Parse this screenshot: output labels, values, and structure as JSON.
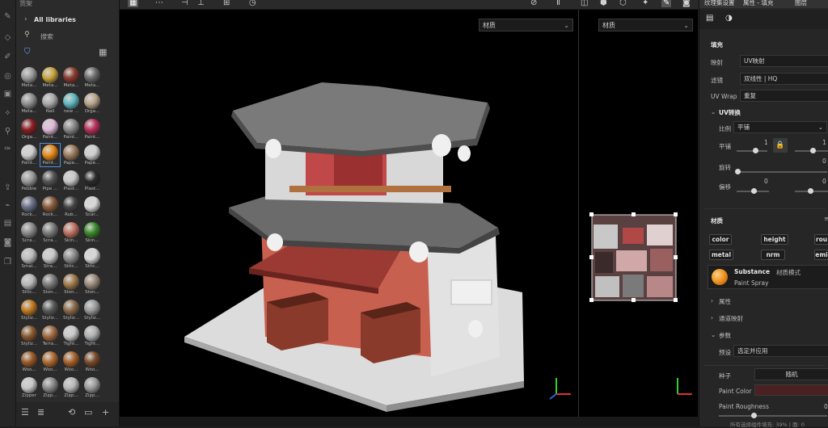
{
  "shelf": {
    "title": "货架",
    "nav_label": "All libraries",
    "search_label": "搜索",
    "swatches": [
      {
        "label": "Meta...",
        "color": "#9a9a9a"
      },
      {
        "label": "Meta...",
        "color": "#c9a53c"
      },
      {
        "label": "Meta...",
        "color": "#8a3b2c"
      },
      {
        "label": "Meta...",
        "color": "#6a6a6a"
      },
      {
        "label": "Meta...",
        "color": "#8f8f8f"
      },
      {
        "label": "Nail",
        "color": "#a9a9a9"
      },
      {
        "label": "new ...",
        "color": "#5fb8c0"
      },
      {
        "label": "Orga...",
        "color": "#b8a48a"
      },
      {
        "label": "Orga...",
        "color": "#8a1e22"
      },
      {
        "label": "Paint...",
        "color": "#e0b8d8"
      },
      {
        "label": "Paint...",
        "color": "#888888"
      },
      {
        "label": "Paint...",
        "color": "#b8305a"
      },
      {
        "label": "Paint...",
        "color": "#cfcfcf"
      },
      {
        "label": "Paint...",
        "color": "#e88a18"
      },
      {
        "label": "Pape...",
        "color": "#9a7a5a"
      },
      {
        "label": "Pape...",
        "color": "#d0d0d0"
      },
      {
        "label": "Pebble",
        "color": "#9a9a9a"
      },
      {
        "label": "Pipe ...",
        "color": "#555555"
      },
      {
        "label": "Plast...",
        "color": "#c8c8c8"
      },
      {
        "label": "Plast...",
        "color": "#2a2a2a"
      },
      {
        "label": "Rock...",
        "color": "#6a7088"
      },
      {
        "label": "Rock...",
        "color": "#8a5a3a"
      },
      {
        "label": "Rub...",
        "color": "#444444"
      },
      {
        "label": "Scar...",
        "color": "#d8d8d8"
      },
      {
        "label": "Scra...",
        "color": "#8a8a8a"
      },
      {
        "label": "Scra...",
        "color": "#7a7a7a"
      },
      {
        "label": "Skin...",
        "color": "#c07060"
      },
      {
        "label": "Skin...",
        "color": "#3a8a2a"
      },
      {
        "label": "Smal...",
        "color": "#bdbdbd"
      },
      {
        "label": "Stra...",
        "color": "#c8c8c8"
      },
      {
        "label": "Stitc...",
        "color": "#8a8a8a"
      },
      {
        "label": "Stitc...",
        "color": "#d8d8d8"
      },
      {
        "label": "Stitc...",
        "color": "#b8b8b8"
      },
      {
        "label": "Ston...",
        "color": "#7a7a7a"
      },
      {
        "label": "Ston...",
        "color": "#a07a4a"
      },
      {
        "label": "Ston...",
        "color": "#9a8a7a"
      },
      {
        "label": "Styliz...",
        "color": "#c07a20"
      },
      {
        "label": "Styliz...",
        "color": "#5a5a5a"
      },
      {
        "label": "Styliz...",
        "color": "#8a6a4a"
      },
      {
        "label": "Styliz...",
        "color": "#9a9a9a"
      },
      {
        "label": "Styliz...",
        "color": "#8a5a30"
      },
      {
        "label": "Terra...",
        "color": "#a06a40"
      },
      {
        "label": "Tight...",
        "color": "#c8c8c8"
      },
      {
        "label": "Tight...",
        "color": "#b0b0b0"
      },
      {
        "label": "Woo...",
        "color": "#9a5a28"
      },
      {
        "label": "Woo...",
        "color": "#b06a30"
      },
      {
        "label": "Woo...",
        "color": "#a8622a"
      },
      {
        "label": "Woo...",
        "color": "#7a4a2a"
      },
      {
        "label": "Zipper",
        "color": "#c8c8c8"
      },
      {
        "label": "Zipp...",
        "color": "#8a8a8a"
      },
      {
        "label": "Zipp...",
        "color": "#b8b8b8"
      },
      {
        "label": "Zipp...",
        "color": "#9a9a9a"
      },
      {
        "label": "Zipp...",
        "color": "#3a2020"
      }
    ],
    "selected_index": 13
  },
  "topbar": {
    "tabs": [
      "纹理集设置",
      "属性 - 填充",
      "图层"
    ]
  },
  "viewport": {
    "dropdown_3d": "材质",
    "dropdown_2d": "材质"
  },
  "props": {
    "section_fill": "填充",
    "mapping_label": "映射",
    "mapping_value": "UV映射",
    "filter_label": "滤镜",
    "filter_value": "双线性 | HQ",
    "uvwrap_label": "UV Wrap",
    "uvwrap_value": "重复",
    "uvtransform_label": "UV转换",
    "scale_label": "比例",
    "scale_value": "平铺",
    "tile_label": "平铺",
    "tile_value_1": "1",
    "tile_value_2": "1",
    "rotate_label": "旋转",
    "rotate_value": "0",
    "offset_label": "偏移",
    "offset_value_1": "0",
    "offset_value_2": "0",
    "material_label": "材质",
    "channels": [
      "color",
      "height",
      "rou",
      "metal",
      "nrm",
      "emi"
    ],
    "substance_title": "Substance",
    "substance_mode": "材质模式",
    "substance_name": "Paint Spray",
    "attributes_label": "属性",
    "channel_mapping_label": "通道映射",
    "params_label": "参数",
    "preset_label": "预设",
    "preset_value": "选定并应用",
    "seed_label": "种子",
    "seed_value": "随机",
    "paint_color_label": "Paint Color",
    "paint_color": "#4a2020",
    "paint_roughness_label": "Paint Roughness",
    "paint_roughness_value": "0",
    "footer": "所有选择组件填充: 39% | 面: 0"
  }
}
